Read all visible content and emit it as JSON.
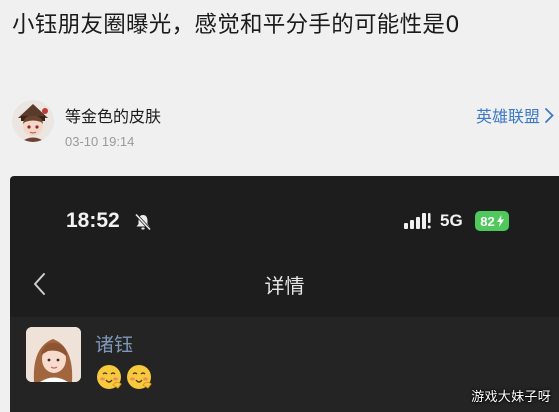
{
  "article": {
    "title": "小钰朋友圈曝光，感觉和平分手的可能性是0"
  },
  "author": {
    "name": "等金色的皮肤",
    "time": "03-10 19:14",
    "avatar_icon": "avatar-cartoon-girl-icon"
  },
  "channel": {
    "label": "英雄联盟",
    "icon": "chevron-right-icon",
    "color": "#3c79c6"
  },
  "screenshot": {
    "status_bar": {
      "time": "18:52",
      "mute_icon": "bell-slash-icon",
      "signal_icon": "signal-bars-icon",
      "network": "5G",
      "battery_level": "82",
      "battery_color": "#4fc95c",
      "charging_icon": "bolt-icon"
    },
    "nav": {
      "back_icon": "chevron-left-icon",
      "title": "详情"
    },
    "post": {
      "poster_name": "诸钰",
      "emojis": [
        "wink-face-emoji",
        "wink-face-emoji"
      ]
    }
  },
  "watermark": "游戏大妹子呀"
}
